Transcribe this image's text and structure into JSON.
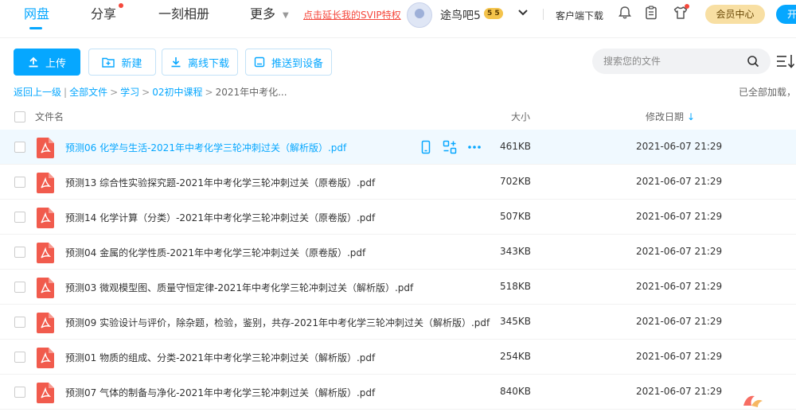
{
  "nav": {
    "tabs": [
      "网盘",
      "分享",
      "一刻相册",
      "更多"
    ],
    "svip_link": "点击延长我的SVIP特权",
    "username": "途鸟吧5",
    "vip_badge": "5 5",
    "client_download": "客户端下载",
    "member_center": "会员中心",
    "renew": "开通"
  },
  "toolbar": {
    "upload": "上传",
    "new": "新建",
    "offline_download": "离线下载",
    "push_device": "推送到设备",
    "search_placeholder": "搜索您的文件"
  },
  "breadcrumb": {
    "back": "返回上一级",
    "items": [
      "全部文件",
      "学习",
      "02初中课程"
    ],
    "current": "2021年中考化...",
    "loaded": "已全部加载，共"
  },
  "columns": {
    "name": "文件名",
    "size": "大小",
    "date": "修改日期"
  },
  "files": [
    {
      "name": "预测06 化学与生活-2021年中考化学三轮冲刺过关（解析版）.pdf",
      "size": "461KB",
      "date": "2021-06-07 21:29"
    },
    {
      "name": "预测13 综合性实验探究题-2021年中考化学三轮冲刺过关（原卷版）.pdf",
      "size": "702KB",
      "date": "2021-06-07 21:29"
    },
    {
      "name": "预测14 化学计算（分类）-2021年中考化学三轮冲刺过关（原卷版）.pdf",
      "size": "507KB",
      "date": "2021-06-07 21:29"
    },
    {
      "name": "预测04 金属的化学性质-2021年中考化学三轮冲刺过关（原卷版）.pdf",
      "size": "343KB",
      "date": "2021-06-07 21:29"
    },
    {
      "name": "预测03 微观模型图、质量守恒定律-2021年中考化学三轮冲刺过关（解析版）.pdf",
      "size": "518KB",
      "date": "2021-06-07 21:29"
    },
    {
      "name": "预测09 实验设计与评价，除杂题，检验，鉴别，共存-2021年中考化学三轮冲刺过关（解析版）.pdf",
      "size": "345KB",
      "date": "2021-06-07 21:29"
    },
    {
      "name": "预测01 物质的组成、分类-2021年中考化学三轮冲刺过关（解析版）.pdf",
      "size": "254KB",
      "date": "2021-06-07 21:29"
    },
    {
      "name": "预测07 气体的制备与净化-2021年中考化学三轮冲刺过关（解析版）.pdf",
      "size": "840KB",
      "date": "2021-06-07 21:29"
    }
  ],
  "colors": {
    "accent": "#06a7ff",
    "pdf_red": "#f15b4d",
    "svip_red": "#f5483c"
  }
}
